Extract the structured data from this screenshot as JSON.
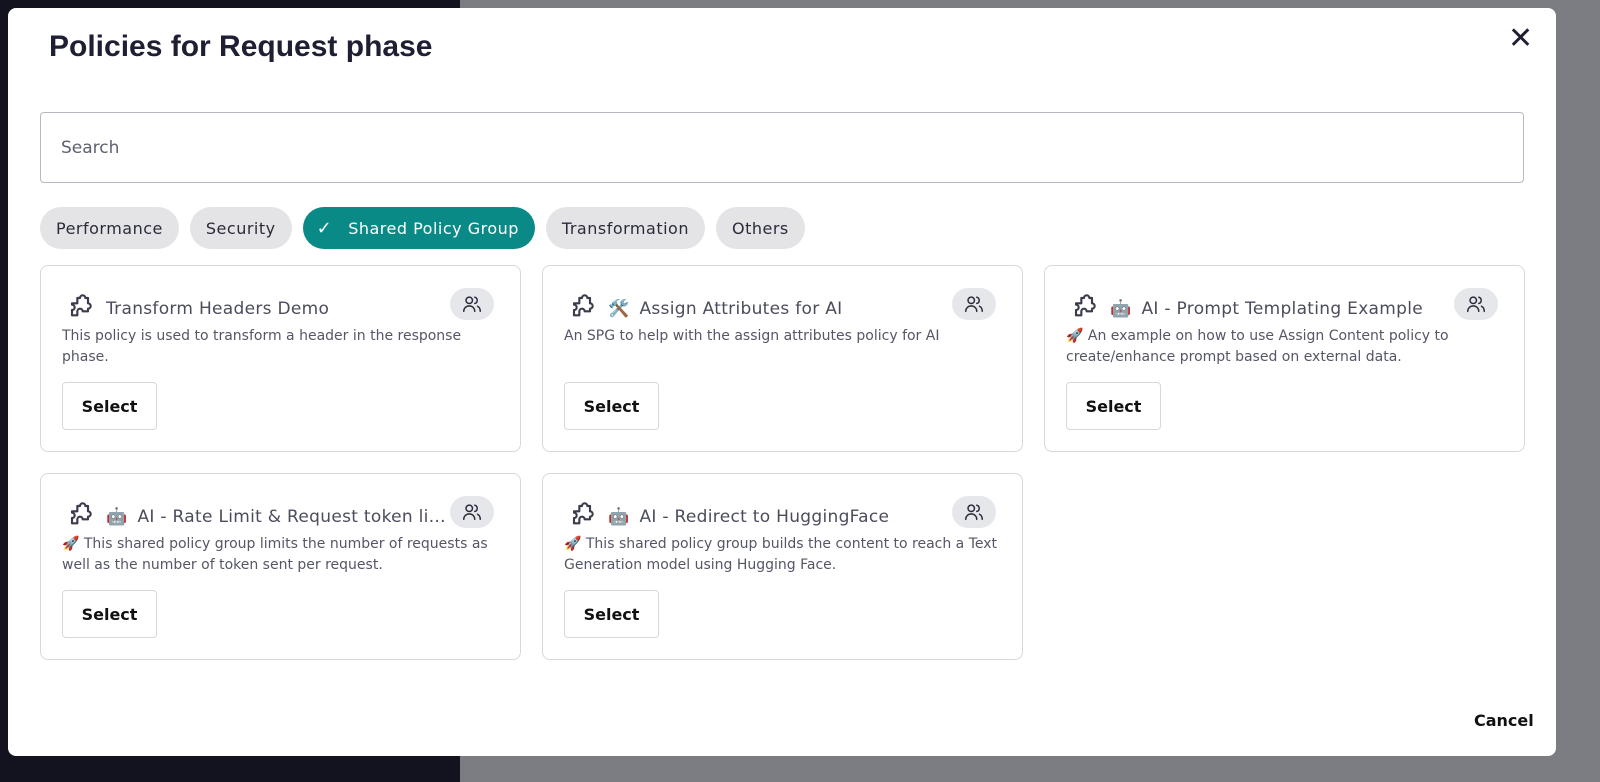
{
  "dialog": {
    "title": "Policies for Request phase",
    "cancel_label": "Cancel"
  },
  "search": {
    "placeholder": "Search",
    "value": ""
  },
  "filters": [
    {
      "label": "Performance",
      "active": false
    },
    {
      "label": "Security",
      "active": false
    },
    {
      "label": "Shared Policy Group",
      "active": true
    },
    {
      "label": "Transformation",
      "active": false
    },
    {
      "label": "Others",
      "active": false
    }
  ],
  "accent_color": "#0a8a86",
  "policies": [
    {
      "emoji": "",
      "title": "Transform Headers Demo",
      "description": "This policy is used to transform a header in the response phase.",
      "select_label": "Select"
    },
    {
      "emoji": "🛠️",
      "title": "Assign Attributes for AI",
      "description": "An SPG to help with the assign attributes policy for AI",
      "select_label": "Select"
    },
    {
      "emoji": "🤖",
      "title": "AI - Prompt Templating Example",
      "description": "🚀 An example on how to use Assign Content policy to create/enhance prompt based on external data.",
      "select_label": "Select"
    },
    {
      "emoji": "🤖",
      "title": "AI - Rate Limit & Request token li...",
      "description": "🚀 This shared policy group limits the number of requests as well as the number of token sent per request.",
      "select_label": "Select"
    },
    {
      "emoji": "🤖",
      "title": "AI - Redirect to HuggingFace",
      "description": "🚀 This shared policy group builds the content to reach a Text Generation model using Hugging Face.",
      "select_label": "Select"
    }
  ]
}
